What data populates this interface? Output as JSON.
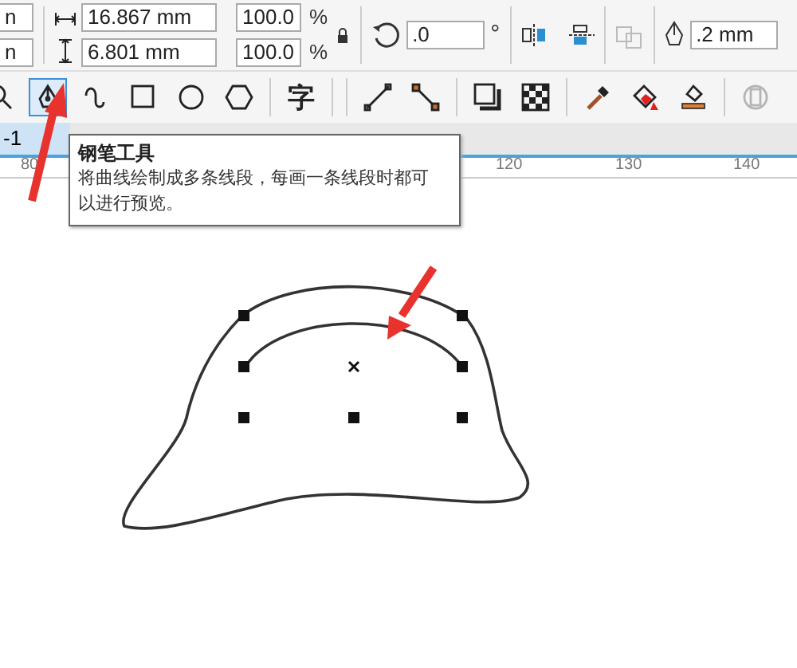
{
  "property_bar": {
    "position_fields": [
      "n",
      "n"
    ],
    "size_fields": [
      "16.867 mm",
      "6.801 mm"
    ],
    "scale_fields": [
      {
        "value": "100.0",
        "unit": "%"
      },
      {
        "value": "100.0",
        "unit": "%"
      }
    ],
    "rotation": {
      "value": ".0",
      "unit": "°"
    },
    "outline_width": ".2 mm"
  },
  "toolbox": [
    {
      "kind": "zoom",
      "selected": false,
      "disabled": false
    },
    {
      "kind": "pen",
      "selected": true,
      "disabled": false
    },
    {
      "kind": "curve",
      "selected": false,
      "disabled": false
    },
    {
      "kind": "rectangle",
      "selected": false,
      "disabled": false
    },
    {
      "kind": "ellipse",
      "selected": false,
      "disabled": false
    },
    {
      "kind": "polygon",
      "selected": false,
      "disabled": false
    },
    {
      "kind": "text",
      "label": "字",
      "selected": false,
      "disabled": false
    },
    {
      "kind": "line",
      "selected": false,
      "disabled": false
    },
    {
      "kind": "connector",
      "selected": false,
      "disabled": false
    },
    {
      "kind": "shadow",
      "selected": false,
      "disabled": false
    },
    {
      "kind": "transparency",
      "selected": false,
      "disabled": false
    },
    {
      "kind": "eyedropper",
      "selected": false,
      "disabled": false
    },
    {
      "kind": "fill",
      "selected": false,
      "disabled": false
    },
    {
      "kind": "smartfill",
      "selected": false,
      "disabled": false
    },
    {
      "kind": "frame",
      "selected": false,
      "disabled": true
    }
  ],
  "document_tabs": [
    {
      "label": "-1",
      "selected": true
    }
  ],
  "ruler": {
    "labels": [
      "80",
      "120",
      "130",
      "140"
    ]
  },
  "tooltip": {
    "title": "钢笔工具",
    "description": "将曲线绘制成多条线段，每画一条线段时都可以进行预览。"
  }
}
